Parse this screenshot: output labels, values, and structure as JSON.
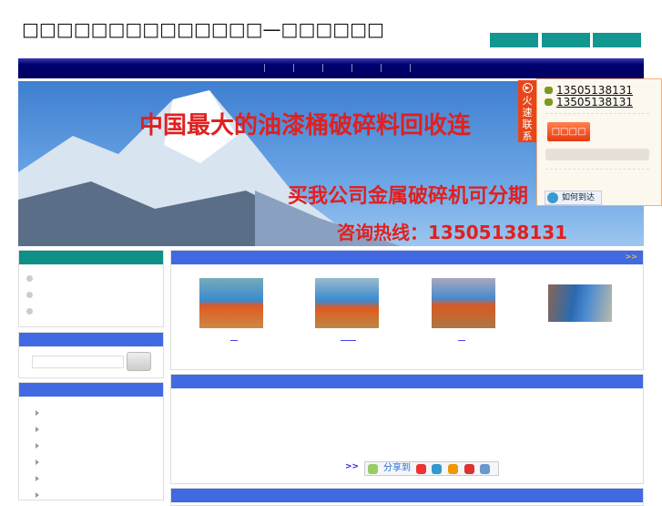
{
  "header": {
    "title": "□□□□□□□□□□□□□□—□□□□□□",
    "top_buttons": [
      "",
      "",
      ""
    ]
  },
  "banner": {
    "line1": "中国最大的油漆桶破碎料回收连",
    "line2": "买我公司金属破碎机可分期",
    "line3": "咨询热线：13505138131"
  },
  "contact_float": {
    "tab_label": "火速联系",
    "phones": [
      "13505138131",
      "13505138131"
    ],
    "button_label": "□□□□",
    "route_label": "如何到达"
  },
  "products": {
    "more_label": ">>"
  },
  "articles": {
    "more_label": ">>",
    "share_label": "分享到"
  },
  "colors": {
    "header_blue": "#4169e1",
    "teal": "#0e8f88",
    "nav": "#000070",
    "accent": "#e8461a"
  }
}
